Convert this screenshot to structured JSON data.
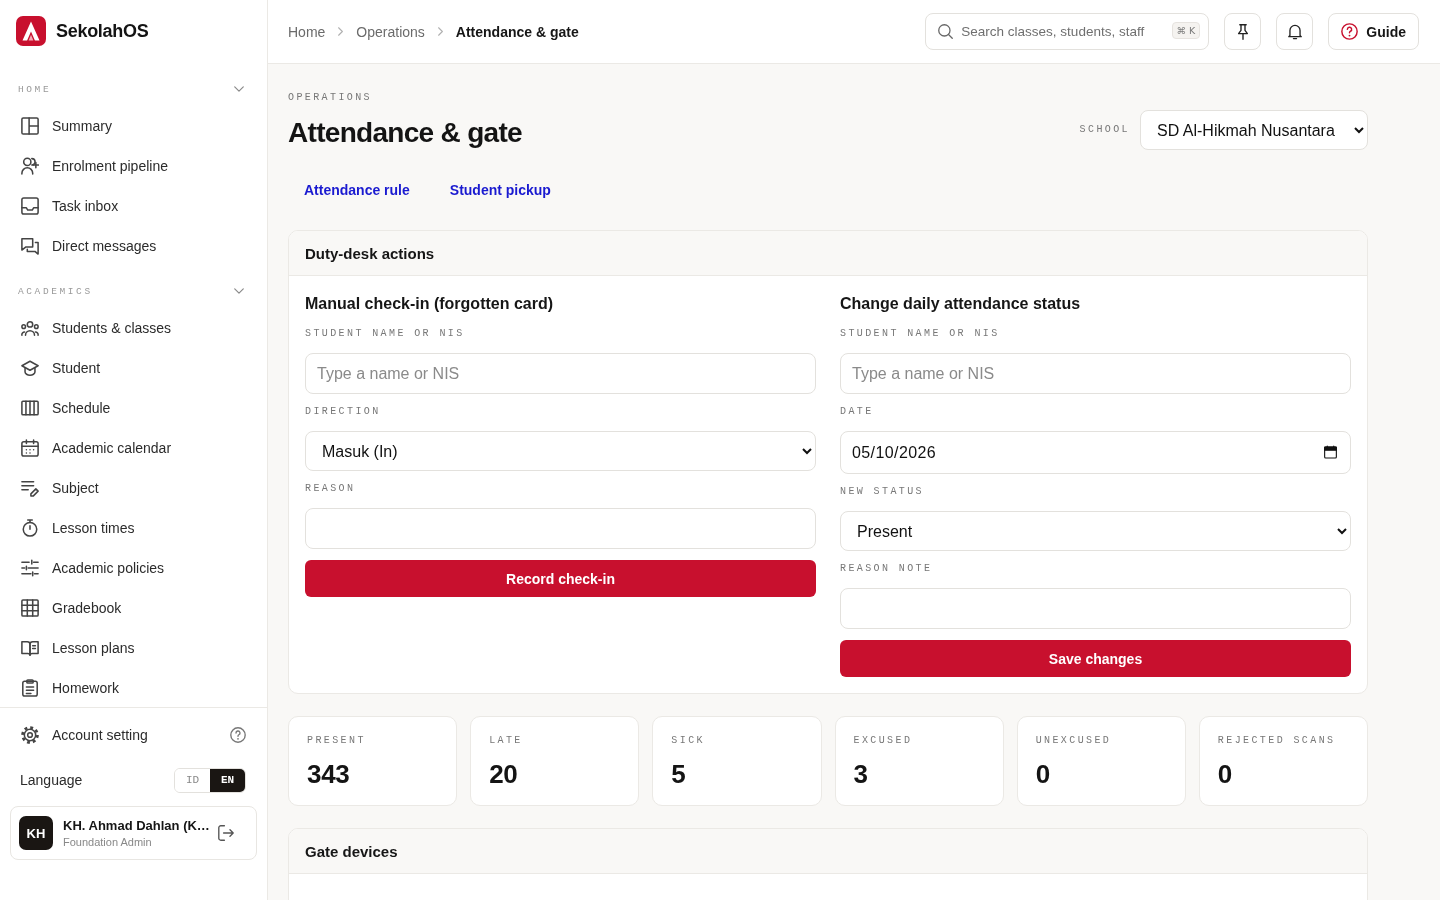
{
  "sidebar": {
    "brand": "SekolahOS",
    "sections": [
      {
        "title": "HOME",
        "expanded": true,
        "items": [
          {
            "label": "Summary",
            "selected": false
          },
          {
            "label": "Enrolment pipeline",
            "selected": false
          },
          {
            "label": "Task inbox",
            "selected": false
          },
          {
            "label": "Direct messages",
            "selected": false
          }
        ]
      },
      {
        "title": "ACADEMICS",
        "expanded": true,
        "items": [
          {
            "label": "Students & classes",
            "selected": false
          },
          {
            "label": "Student",
            "selected": false
          },
          {
            "label": "Schedule",
            "selected": false
          },
          {
            "label": "Academic calendar",
            "selected": false
          },
          {
            "label": "Subject",
            "selected": false
          },
          {
            "label": "Lesson times",
            "selected": false
          },
          {
            "label": "Academic policies",
            "selected": false
          },
          {
            "label": "Gradebook",
            "selected": false
          },
          {
            "label": "Lesson plans",
            "selected": false
          },
          {
            "label": "Homework",
            "selected": false
          }
        ]
      }
    ],
    "footer": {
      "account_setting": "Account setting",
      "language": {
        "label": "Language",
        "options": [
          {
            "label": "ID",
            "selected": false
          },
          {
            "label": "EN",
            "selected": true
          }
        ]
      },
      "user": {
        "initials": "KH",
        "name": "KH. Ahmad Dahlan (K…",
        "role": "Foundation Admin"
      }
    }
  },
  "topbar": {
    "breadcrumbs": [
      {
        "label": "Home",
        "current": false
      },
      {
        "label": "Operations",
        "current": false
      },
      {
        "label": "Attendance & gate",
        "current": true
      }
    ],
    "search": {
      "placeholder": "Search classes, students, staff",
      "shortcut": "⌘ K"
    },
    "guide_button": "Guide"
  },
  "page": {
    "eyebrow": "OPERATIONS",
    "title": "Attendance & gate",
    "school": {
      "label": "SCHOOL",
      "value": "SD Al-Hikmah Nusantara"
    },
    "links": [
      {
        "label": "Attendance rule"
      },
      {
        "label": "Student pickup"
      }
    ],
    "duty_desk": {
      "title": "Duty-desk actions",
      "forms": [
        {
          "title": "Manual check-in (forgotten card)",
          "fields": [
            {
              "kind": "text",
              "label": "STUDENT NAME OR NIS",
              "placeholder": "Type a name or NIS"
            },
            {
              "kind": "select",
              "label": "DIRECTION",
              "value": "Masuk (In)"
            },
            {
              "kind": "text",
              "label": "REASON"
            }
          ],
          "submit": "Record check-in"
        },
        {
          "title": "Change daily attendance status",
          "fields": [
            {
              "kind": "text",
              "label": "STUDENT NAME OR NIS",
              "placeholder": "Type a name or NIS"
            },
            {
              "kind": "date",
              "label": "DATE",
              "value": "05/10/2026"
            },
            {
              "kind": "select",
              "label": "NEW STATUS",
              "value": "Present"
            },
            {
              "kind": "text",
              "label": "REASON NOTE"
            }
          ],
          "submit": "Save changes"
        }
      ]
    },
    "stats": [
      {
        "label": "PRESENT",
        "value": "343"
      },
      {
        "label": "LATE",
        "value": "20"
      },
      {
        "label": "SICK",
        "value": "5"
      },
      {
        "label": "EXCUSED",
        "value": "3"
      },
      {
        "label": "UNEXCUSED",
        "value": "0"
      },
      {
        "label": "REJECTED SCANS",
        "value": "0"
      }
    ],
    "gate_devices": {
      "title": "Gate devices"
    }
  }
}
